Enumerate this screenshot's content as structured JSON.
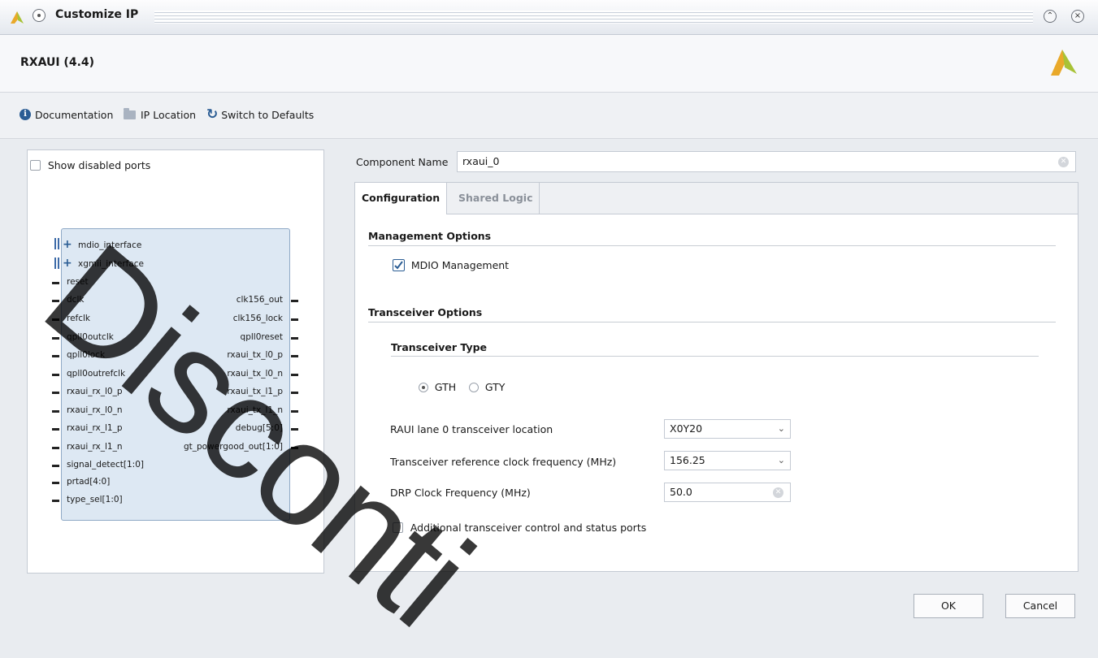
{
  "window": {
    "title": "Customize IP",
    "ip_name": "RXAUI (4.4)"
  },
  "toolbar": {
    "documentation": "Documentation",
    "ip_location": "IP Location",
    "switch_defaults": "Switch to Defaults"
  },
  "left": {
    "show_disabled": "Show disabled ports",
    "bus_ports": [
      "mdio_interface",
      "xgmii_interface"
    ],
    "left_ports": [
      "reset",
      "dclk",
      "refclk",
      "qpll0outclk",
      "qpll0lock",
      "qpll0outrefclk",
      "rxaui_rx_l0_p",
      "rxaui_rx_l0_n",
      "rxaui_rx_l1_p",
      "rxaui_rx_l1_n",
      "signal_detect[1:0]",
      "prtad[4:0]",
      "type_sel[1:0]"
    ],
    "right_ports": [
      "clk156_out",
      "clk156_lock",
      "qpll0reset",
      "rxaui_tx_l0_p",
      "rxaui_tx_l0_n",
      "rxaui_tx_l1_p",
      "rxaui_tx_l1_n",
      "debug[5:0]",
      "gt_powergood_out[1:0]"
    ]
  },
  "component": {
    "label": "Component Name",
    "value": "rxaui_0"
  },
  "tabs": [
    "Configuration",
    "Shared Logic"
  ],
  "config": {
    "mgmt_header": "Management Options",
    "mdio_label": "MDIO Management",
    "mdio_checked": true,
    "xcvr_header": "Transceiver Options",
    "xcvr_type_header": "Transceiver Type",
    "type_options": [
      "GTH",
      "GTY"
    ],
    "type_selected": "GTH",
    "lane_label": "RAUI lane 0 transceiver location",
    "lane_value": "X0Y20",
    "refclk_label": "Transceiver reference clock frequency (MHz)",
    "refclk_value": "156.25",
    "drp_label": "DRP Clock Frequency (MHz)",
    "drp_value": "50.0",
    "additional_label": "Additional transceiver control and status ports",
    "additional_checked": false
  },
  "buttons": {
    "ok": "OK",
    "cancel": "Cancel"
  },
  "watermark": "Disconti",
  "colors": {
    "accent": "#2b5d94",
    "block_fill": "#dde8f3",
    "logo": "#e9a92a"
  }
}
